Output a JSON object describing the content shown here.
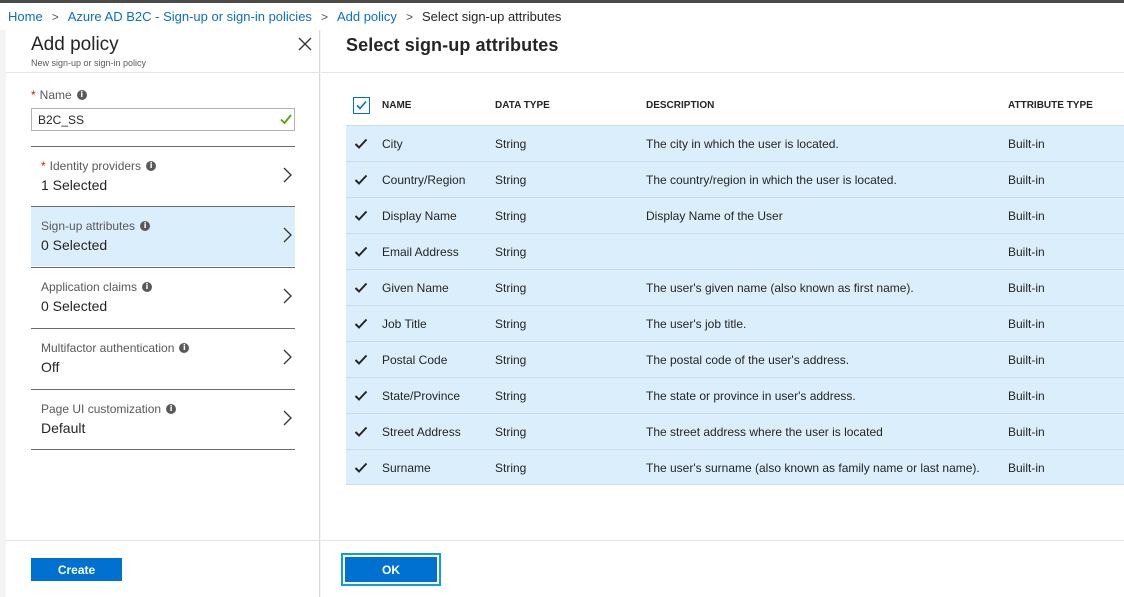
{
  "breadcrumb": {
    "home": "Home",
    "b2c": "Azure AD B2C - Sign-up or sign-in policies",
    "add_policy": "Add policy",
    "current": "Select sign-up attributes",
    "separator": ">"
  },
  "left_blade": {
    "title": "Add policy",
    "subtitle": "New sign-up or sign-in policy",
    "name_field": {
      "required_mark": "*",
      "label": "Name",
      "value": "B2C_SS"
    },
    "items": [
      {
        "required_mark": "*",
        "label": "Identity providers",
        "value": "1 Selected"
      },
      {
        "required_mark": "",
        "label": "Sign-up attributes",
        "value": "0 Selected"
      },
      {
        "required_mark": "",
        "label": "Application claims",
        "value": "0 Selected"
      },
      {
        "required_mark": "",
        "label": "Multifactor authentication",
        "value": "Off"
      },
      {
        "required_mark": "",
        "label": "Page UI customization",
        "value": "Default"
      }
    ],
    "create_label": "Create",
    "info_glyph": "i"
  },
  "right_blade": {
    "title": "Select sign-up attributes",
    "columns": {
      "name": "NAME",
      "data_type": "DATA TYPE",
      "description": "DESCRIPTION",
      "attribute_type": "ATTRIBUTE TYPE"
    },
    "rows": [
      {
        "name": "City",
        "data_type": "String",
        "description": "The city in which the user is located.",
        "attribute_type": "Built-in",
        "checked": true
      },
      {
        "name": "Country/Region",
        "data_type": "String",
        "description": "The country/region in which the user is located.",
        "attribute_type": "Built-in",
        "checked": true
      },
      {
        "name": "Display Name",
        "data_type": "String",
        "description": "Display Name of the User",
        "attribute_type": "Built-in",
        "checked": true
      },
      {
        "name": "Email Address",
        "data_type": "String",
        "description": "",
        "attribute_type": "Built-in",
        "checked": true
      },
      {
        "name": "Given Name",
        "data_type": "String",
        "description": "The user's given name (also known as first name).",
        "attribute_type": "Built-in",
        "checked": true
      },
      {
        "name": "Job Title",
        "data_type": "String",
        "description": "The user's job title.",
        "attribute_type": "Built-in",
        "checked": true
      },
      {
        "name": "Postal Code",
        "data_type": "String",
        "description": "The postal code of the user's address.",
        "attribute_type": "Built-in",
        "checked": true
      },
      {
        "name": "State/Province",
        "data_type": "String",
        "description": "The state or province in user's address.",
        "attribute_type": "Built-in",
        "checked": true
      },
      {
        "name": "Street Address",
        "data_type": "String",
        "description": "The street address where the user is located",
        "attribute_type": "Built-in",
        "checked": true
      },
      {
        "name": "Surname",
        "data_type": "String",
        "description": "The user's surname (also known as family name or last name).",
        "attribute_type": "Built-in",
        "checked": true
      }
    ],
    "ok_label": "OK"
  },
  "colors": {
    "accent": "#0070d1",
    "link": "#0a6ec7",
    "selected_bg": "#dbeefc",
    "required": "#e00b1c",
    "valid": "#57a300",
    "focus_ring": "#0c9ed8"
  },
  "icons": {
    "close": "close-icon",
    "info": "info-icon",
    "chevron": "chevron-right-icon",
    "check": "checkmark-icon",
    "valid": "valid-checkmark-icon"
  }
}
